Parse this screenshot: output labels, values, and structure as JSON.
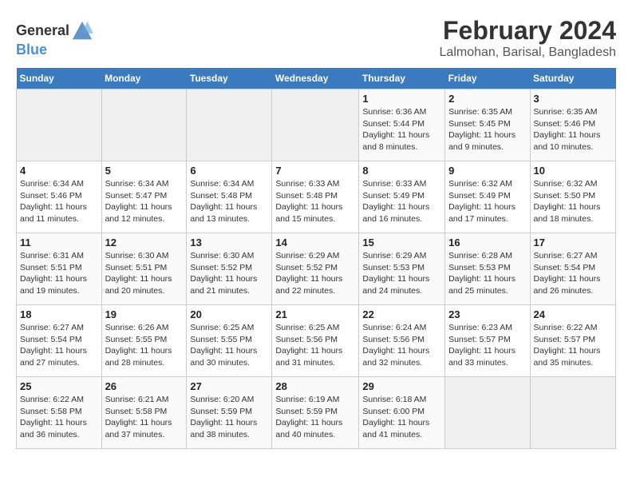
{
  "header": {
    "logo_general": "General",
    "logo_blue": "Blue",
    "month_year": "February 2024",
    "location": "Lalmohan, Barisal, Bangladesh"
  },
  "days_of_week": [
    "Sunday",
    "Monday",
    "Tuesday",
    "Wednesday",
    "Thursday",
    "Friday",
    "Saturday"
  ],
  "weeks": [
    [
      {
        "day": "",
        "info": ""
      },
      {
        "day": "",
        "info": ""
      },
      {
        "day": "",
        "info": ""
      },
      {
        "day": "",
        "info": ""
      },
      {
        "day": "1",
        "info": "Sunrise: 6:36 AM\nSunset: 5:44 PM\nDaylight: 11 hours and 8 minutes."
      },
      {
        "day": "2",
        "info": "Sunrise: 6:35 AM\nSunset: 5:45 PM\nDaylight: 11 hours and 9 minutes."
      },
      {
        "day": "3",
        "info": "Sunrise: 6:35 AM\nSunset: 5:46 PM\nDaylight: 11 hours and 10 minutes."
      }
    ],
    [
      {
        "day": "4",
        "info": "Sunrise: 6:34 AM\nSunset: 5:46 PM\nDaylight: 11 hours and 11 minutes."
      },
      {
        "day": "5",
        "info": "Sunrise: 6:34 AM\nSunset: 5:47 PM\nDaylight: 11 hours and 12 minutes."
      },
      {
        "day": "6",
        "info": "Sunrise: 6:34 AM\nSunset: 5:48 PM\nDaylight: 11 hours and 13 minutes."
      },
      {
        "day": "7",
        "info": "Sunrise: 6:33 AM\nSunset: 5:48 PM\nDaylight: 11 hours and 15 minutes."
      },
      {
        "day": "8",
        "info": "Sunrise: 6:33 AM\nSunset: 5:49 PM\nDaylight: 11 hours and 16 minutes."
      },
      {
        "day": "9",
        "info": "Sunrise: 6:32 AM\nSunset: 5:49 PM\nDaylight: 11 hours and 17 minutes."
      },
      {
        "day": "10",
        "info": "Sunrise: 6:32 AM\nSunset: 5:50 PM\nDaylight: 11 hours and 18 minutes."
      }
    ],
    [
      {
        "day": "11",
        "info": "Sunrise: 6:31 AM\nSunset: 5:51 PM\nDaylight: 11 hours and 19 minutes."
      },
      {
        "day": "12",
        "info": "Sunrise: 6:30 AM\nSunset: 5:51 PM\nDaylight: 11 hours and 20 minutes."
      },
      {
        "day": "13",
        "info": "Sunrise: 6:30 AM\nSunset: 5:52 PM\nDaylight: 11 hours and 21 minutes."
      },
      {
        "day": "14",
        "info": "Sunrise: 6:29 AM\nSunset: 5:52 PM\nDaylight: 11 hours and 22 minutes."
      },
      {
        "day": "15",
        "info": "Sunrise: 6:29 AM\nSunset: 5:53 PM\nDaylight: 11 hours and 24 minutes."
      },
      {
        "day": "16",
        "info": "Sunrise: 6:28 AM\nSunset: 5:53 PM\nDaylight: 11 hours and 25 minutes."
      },
      {
        "day": "17",
        "info": "Sunrise: 6:27 AM\nSunset: 5:54 PM\nDaylight: 11 hours and 26 minutes."
      }
    ],
    [
      {
        "day": "18",
        "info": "Sunrise: 6:27 AM\nSunset: 5:54 PM\nDaylight: 11 hours and 27 minutes."
      },
      {
        "day": "19",
        "info": "Sunrise: 6:26 AM\nSunset: 5:55 PM\nDaylight: 11 hours and 28 minutes."
      },
      {
        "day": "20",
        "info": "Sunrise: 6:25 AM\nSunset: 5:55 PM\nDaylight: 11 hours and 30 minutes."
      },
      {
        "day": "21",
        "info": "Sunrise: 6:25 AM\nSunset: 5:56 PM\nDaylight: 11 hours and 31 minutes."
      },
      {
        "day": "22",
        "info": "Sunrise: 6:24 AM\nSunset: 5:56 PM\nDaylight: 11 hours and 32 minutes."
      },
      {
        "day": "23",
        "info": "Sunrise: 6:23 AM\nSunset: 5:57 PM\nDaylight: 11 hours and 33 minutes."
      },
      {
        "day": "24",
        "info": "Sunrise: 6:22 AM\nSunset: 5:57 PM\nDaylight: 11 hours and 35 minutes."
      }
    ],
    [
      {
        "day": "25",
        "info": "Sunrise: 6:22 AM\nSunset: 5:58 PM\nDaylight: 11 hours and 36 minutes."
      },
      {
        "day": "26",
        "info": "Sunrise: 6:21 AM\nSunset: 5:58 PM\nDaylight: 11 hours and 37 minutes."
      },
      {
        "day": "27",
        "info": "Sunrise: 6:20 AM\nSunset: 5:59 PM\nDaylight: 11 hours and 38 minutes."
      },
      {
        "day": "28",
        "info": "Sunrise: 6:19 AM\nSunset: 5:59 PM\nDaylight: 11 hours and 40 minutes."
      },
      {
        "day": "29",
        "info": "Sunrise: 6:18 AM\nSunset: 6:00 PM\nDaylight: 11 hours and 41 minutes."
      },
      {
        "day": "",
        "info": ""
      },
      {
        "day": "",
        "info": ""
      }
    ]
  ]
}
